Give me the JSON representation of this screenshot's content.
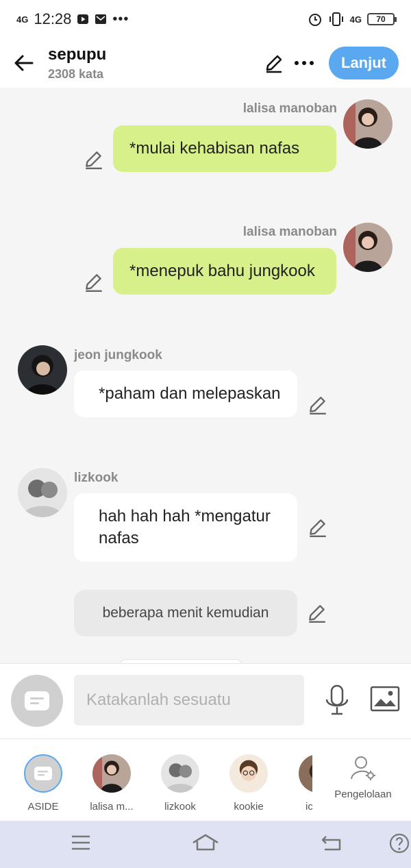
{
  "status": {
    "time": "12:28",
    "net_left": "4G",
    "net_right": "4G",
    "battery": "70"
  },
  "header": {
    "title": "sepupu",
    "word_count": "2308 kata",
    "next_label": "Lanjut"
  },
  "messages": [
    {
      "sender": "lalisa manoban",
      "text": "*mulai kehabisan nafas"
    },
    {
      "sender": "lalisa manoban",
      "text": "*menepuk bahu jungkook"
    },
    {
      "sender": "jeon jungkook",
      "text": "*paham dan melepaskan"
    },
    {
      "sender": "lizkook",
      "text": "hah hah hah *mengatur nafas"
    }
  ],
  "narration": "beberapa menit kemudian",
  "input": {
    "placeholder": "Katakanlah sesuatu"
  },
  "characters": [
    {
      "name": "ASIDE"
    },
    {
      "name": "lalisa m..."
    },
    {
      "name": "lizkook"
    },
    {
      "name": "kookie"
    },
    {
      "name": "ic"
    }
  ],
  "manage_label": "Pengelolaan",
  "icons": [
    "back-arrow-icon",
    "edit-icon",
    "more-icon",
    "mic-icon",
    "image-icon",
    "aside-icon",
    "manage-icon",
    "menu-icon",
    "home-icon",
    "back-icon",
    "help-icon"
  ],
  "colors": {
    "accent": "#5aa9f0",
    "bubble_green": "#d8f08a",
    "navbar": "#dfe2f3"
  }
}
